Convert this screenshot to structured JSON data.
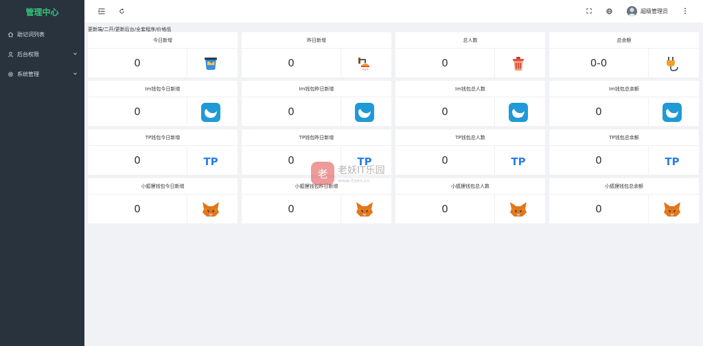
{
  "sidebar": {
    "brand": "管理中心",
    "items": [
      {
        "label": "助记词列表",
        "icon": "home-icon",
        "has_children": false
      },
      {
        "label": "后台权限",
        "icon": "user-icon",
        "has_children": true
      },
      {
        "label": "系统管理",
        "icon": "gear-icon",
        "has_children": true
      }
    ]
  },
  "topbar": {
    "user_name": "超级管理员",
    "icons": [
      "menu-fold-icon",
      "refresh-icon",
      "fullscreen-icon",
      "globe-icon",
      "more-vertical-icon"
    ]
  },
  "notice": "更新端/二开/更新后台/全套程序/价格低",
  "cards": [
    {
      "title": "今日新增",
      "value": "0",
      "icon": "paint-bucket-icon"
    },
    {
      "title": "昨日新增",
      "value": "0",
      "icon": "faucet-icon"
    },
    {
      "title": "总人数",
      "value": "0",
      "icon": "trash-bin-icon"
    },
    {
      "title": "总余额",
      "value": "0-0",
      "icon": "plug-icon"
    },
    {
      "title": "Im钱包今日新增",
      "value": "0",
      "icon": "imtoken-logo-icon"
    },
    {
      "title": "Im钱包昨日新增",
      "value": "0",
      "icon": "imtoken-logo-icon"
    },
    {
      "title": "Im钱包总人数",
      "value": "0",
      "icon": "imtoken-logo-icon"
    },
    {
      "title": "Im钱包总余额",
      "value": "0",
      "icon": "imtoken-logo-icon"
    },
    {
      "title": "TP钱包今日新增",
      "value": "0",
      "icon": "tp-logo-icon",
      "icon_text": "TP"
    },
    {
      "title": "TP钱包昨日新增",
      "value": "0",
      "icon": "tp-logo-icon",
      "icon_text": "TP"
    },
    {
      "title": "TP钱包总人数",
      "value": "0",
      "icon": "tp-logo-icon",
      "icon_text": "TP"
    },
    {
      "title": "TP钱包总余额",
      "value": "0",
      "icon": "tp-logo-icon",
      "icon_text": "TP"
    },
    {
      "title": "小狐狸钱包今日新增",
      "value": "0",
      "icon": "metamask-fox-icon"
    },
    {
      "title": "小狐狸钱包昨日新增",
      "value": "0",
      "icon": "metamask-fox-icon"
    },
    {
      "title": "小狐狸钱包总人数",
      "value": "0",
      "icon": "metamask-fox-icon"
    },
    {
      "title": "小狐狸钱包总余额",
      "value": "0",
      "icon": "metamask-fox-icon"
    }
  ],
  "watermark": {
    "badge": "老",
    "title": "老妖IT乐园",
    "url": "www.itxen.cn"
  },
  "colors": {
    "sidebar_bg": "#28333e",
    "brand": "#32c77d",
    "tp_blue": "#2a7ee8",
    "imtoken_blue": "#1f9ad6"
  }
}
